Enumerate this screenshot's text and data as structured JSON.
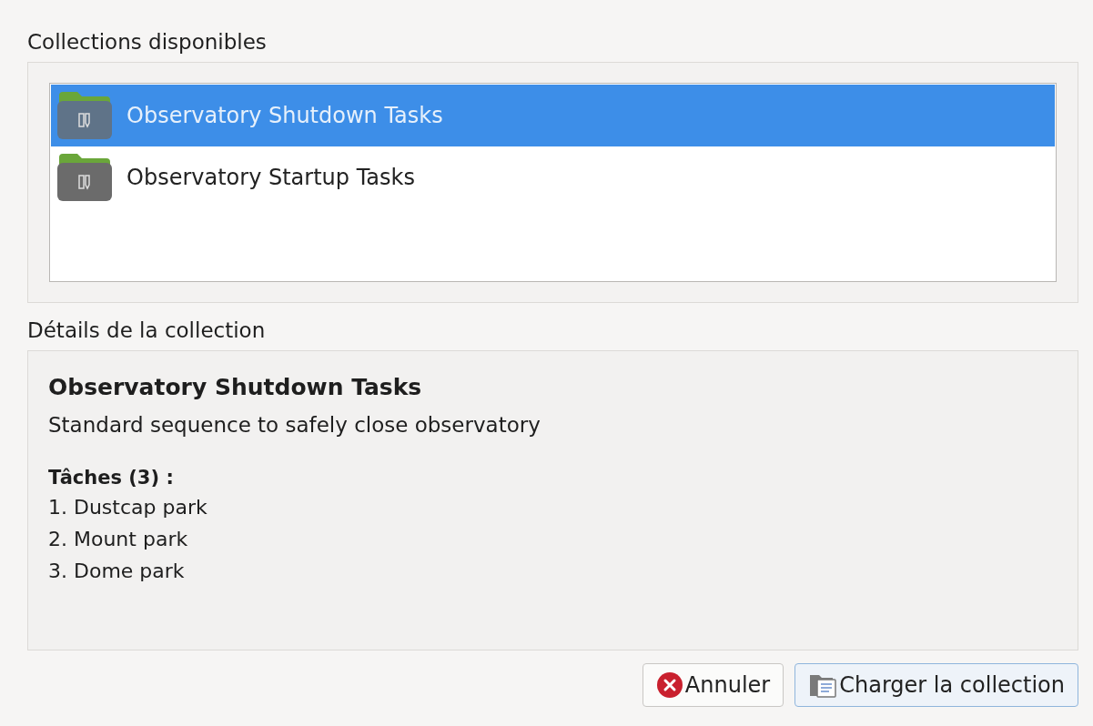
{
  "collections": {
    "label": "Collections disponibles",
    "items": [
      {
        "name": "Observatory Shutdown Tasks",
        "selected": true
      },
      {
        "name": "Observatory Startup Tasks",
        "selected": false
      }
    ]
  },
  "details": {
    "label": "Détails de la collection",
    "title": "Observatory Shutdown Tasks",
    "description": "Standard sequence to safely close observatory",
    "tasks_heading": "Tâches (3) :",
    "tasks": [
      "1. Dustcap park",
      "2. Mount park",
      "3. Dome park"
    ]
  },
  "buttons": [
    {
      "kind": "cancel",
      "label": "Annuler",
      "default": false
    },
    {
      "kind": "load",
      "label": "Charger la collection",
      "default": true
    }
  ]
}
